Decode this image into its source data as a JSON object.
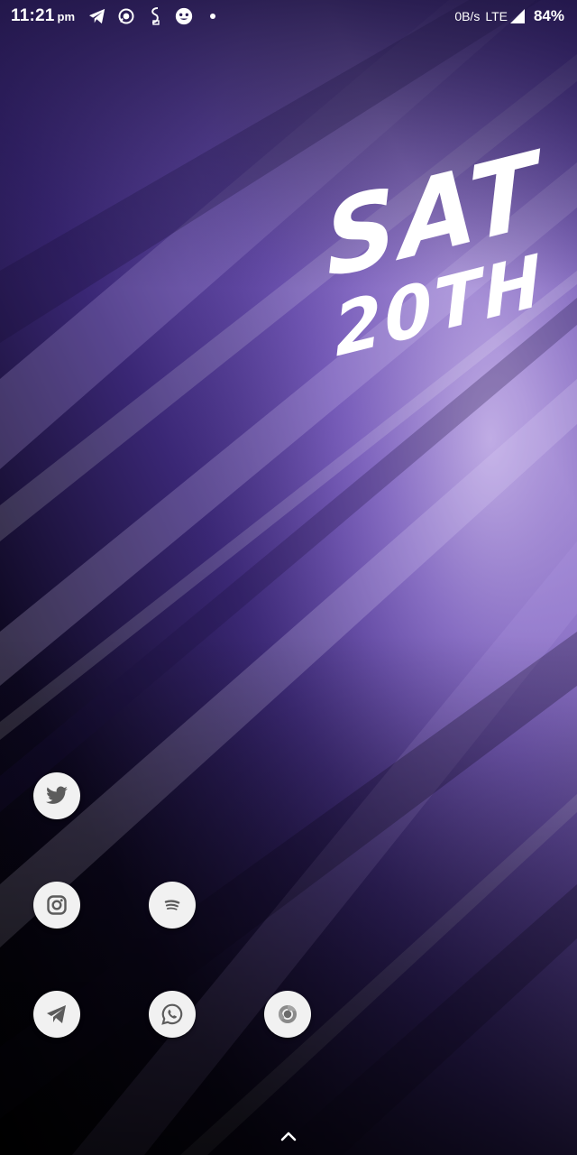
{
  "status_bar": {
    "time": "11:21",
    "ampm": "pm",
    "notification_icons": [
      "telegram-icon",
      "whatsapp-icon",
      "swiftkey-icon",
      "face-icon",
      "more-notifications-dot"
    ],
    "net_speed": "0B/s",
    "network": "LTE",
    "battery": "84%"
  },
  "date_widget": {
    "day": "SAT",
    "date": "20TH"
  },
  "apps": [
    {
      "name": "Twitter",
      "icon": "twitter-icon"
    },
    {
      "name": "Instagram",
      "icon": "instagram-icon"
    },
    {
      "name": "Spotify",
      "icon": "spotify-icon"
    },
    {
      "name": "Telegram",
      "icon": "telegram-icon"
    },
    {
      "name": "WhatsApp",
      "icon": "whatsapp-icon"
    },
    {
      "name": "Chrome",
      "icon": "chrome-icon"
    }
  ],
  "app_drawer": {
    "icon": "chevron-up-icon"
  },
  "colors": {
    "wallpaper_dark": "#1a0f3a",
    "wallpaper_mid": "#5a3fa0",
    "wallpaper_light": "#b8a3dc",
    "icon_bg": "#f1f1f1",
    "icon_glyph": "#5c5c5c"
  }
}
